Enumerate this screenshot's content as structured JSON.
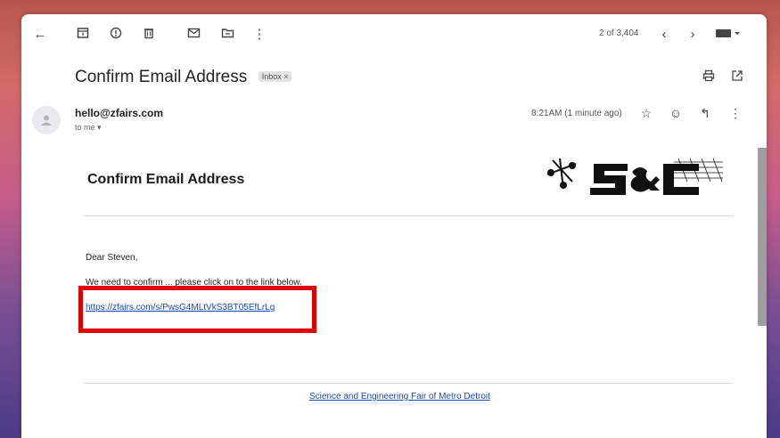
{
  "toolbar": {
    "counter": "2 of 3,404",
    "icons": [
      "back-arrow-icon",
      "archive-icon",
      "report-spam-icon",
      "delete-icon",
      "mark-unread-icon",
      "move-to-icon",
      "more-vert-icon",
      "prev-icon",
      "next-icon",
      "keyboard-icon"
    ]
  },
  "email": {
    "subject": "Confirm Email Address",
    "label_chip": "Inbox ×",
    "sender": "hello@zfairs.com",
    "recipient": "to me ▾",
    "time": "8:21AM (1 minute ago)",
    "body_title": "Confirm Email Address",
    "greeting": "Dear Steven,",
    "paragraph": "We need to confirm ... please click on to the link below.",
    "link": "https://zfairs.com/s/PwsG4MLtVkS3BT05EfLrLg",
    "footer_link": "Science and Engineering Fair of Metro Detroit"
  },
  "colors": {
    "highlight_box": "#e00000",
    "link": "#1a47b8"
  }
}
